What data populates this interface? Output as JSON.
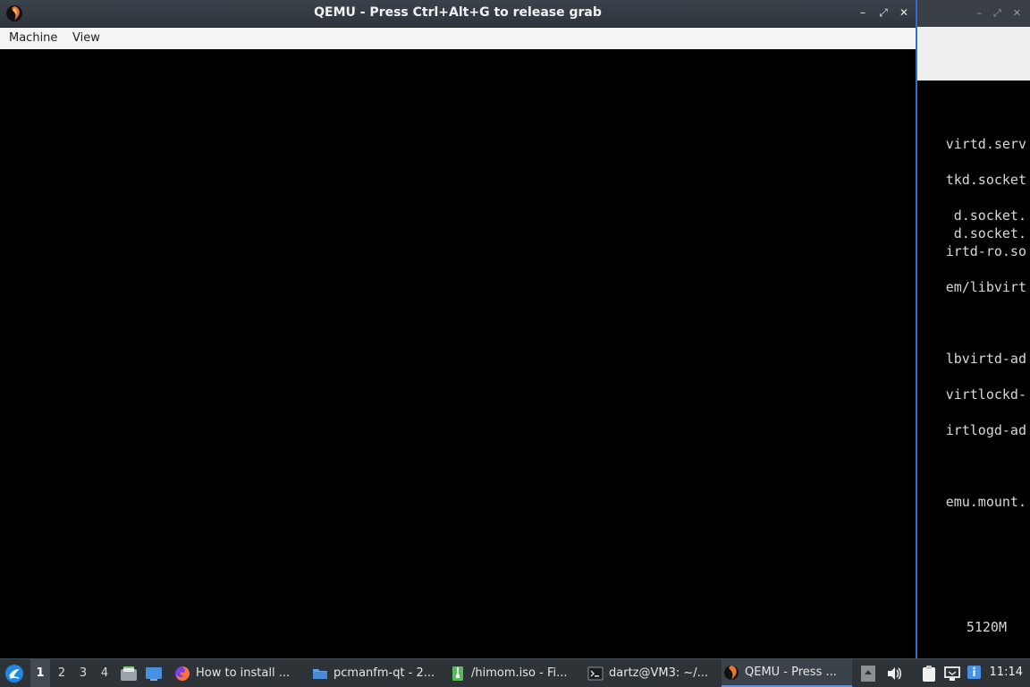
{
  "qemu": {
    "title": "QEMU - Press Ctrl+Alt+G to release grab",
    "menu": [
      "Machine",
      "View"
    ],
    "controls": {
      "minimize": "–",
      "maximize": "⤢",
      "close": "✕"
    }
  },
  "background_terminal": {
    "controls": [
      "–",
      "⤢",
      "✕"
    ],
    "lines": [
      "virtd.serv",
      "tkd.socket",
      "d.socket.",
      "d.socket.",
      "irtd-ro.so",
      "em/libvirt",
      "lbvirtd-ad",
      "virtlockd-",
      "irtlogd-ad",
      "emu.mount.",
      "5120M"
    ]
  },
  "taskbar": {
    "desktops": [
      "1",
      "2",
      "3",
      "4"
    ],
    "active_desktop": "1",
    "tasks": [
      {
        "label": "How to install ...",
        "icon": "firefox-icon"
      },
      {
        "label": "pcmanfm-qt - 2...",
        "icon": "folder-icon"
      },
      {
        "label": "/himom.iso - Fi...",
        "icon": "archive-icon"
      },
      {
        "label": "dartz@VM3: ~/...",
        "icon": "terminal-icon"
      },
      {
        "label": "QEMU - Press ...",
        "icon": "qemu-icon"
      }
    ],
    "clock": "11:14"
  },
  "colors": {
    "accent": "#2e6fd0",
    "taskbar_bg": "#2e3338",
    "titlebar_bg": "#353b42",
    "screen_bg": "#000000"
  }
}
